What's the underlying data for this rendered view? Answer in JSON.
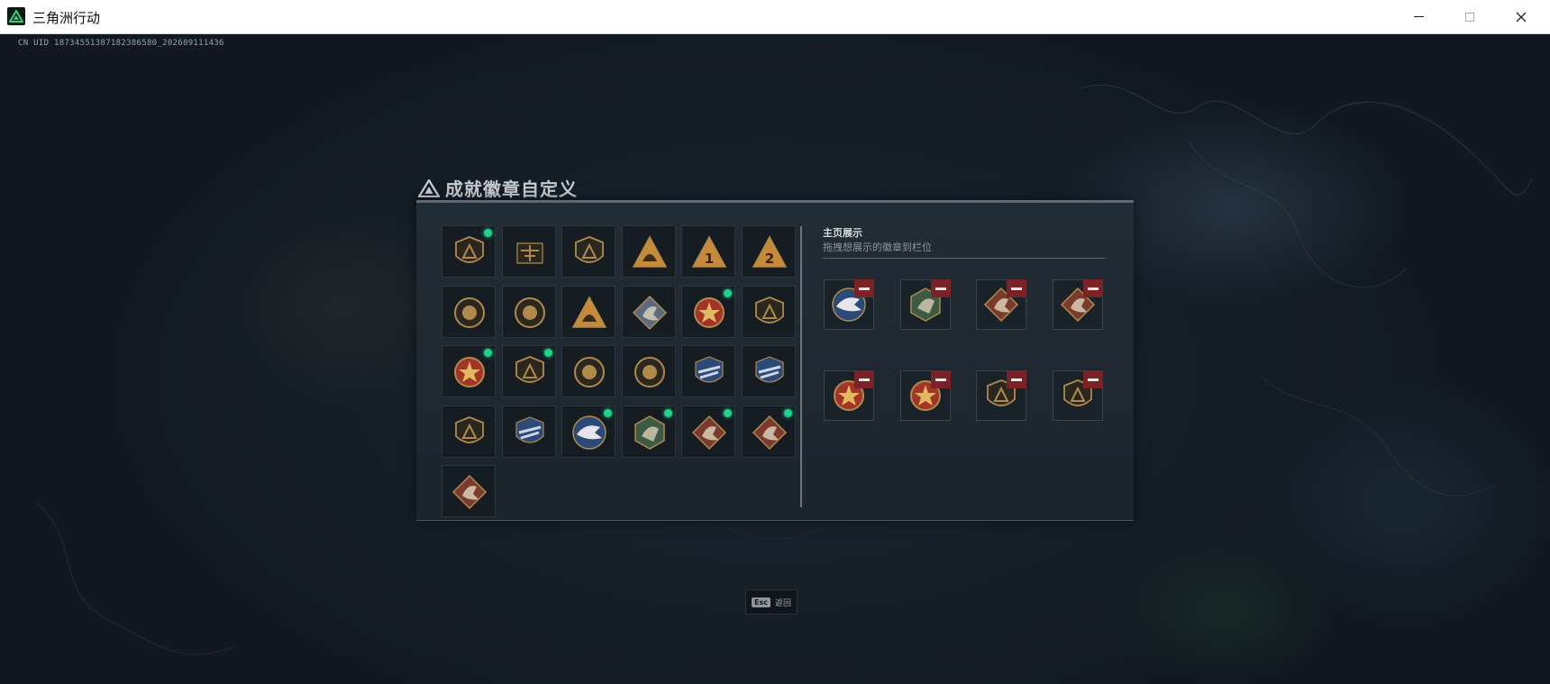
{
  "window": {
    "title": "三角洲行动",
    "controls": [
      "minimize-icon",
      "maximize-icon",
      "close-icon"
    ]
  },
  "uid_text": "CN UID 18734551387182386580_202609111436",
  "panel": {
    "title": "成就徽章自定义",
    "title_icon": "triangle-emblem-icon"
  },
  "colors": {
    "new_indicator": "#1fd38a",
    "remove_button": "#7a2226"
  },
  "badge_grid": [
    {
      "icon": "shield-triangle-badge",
      "new": true
    },
    {
      "icon": "helicopter-badge",
      "new": false
    },
    {
      "icon": "shield-arrow-badge",
      "new": false
    },
    {
      "icon": "triangle-helmet-badge",
      "new": false
    },
    {
      "icon": "triangle-number-1-badge",
      "new": false
    },
    {
      "icon": "triangle-number-2-badge",
      "new": false
    },
    {
      "icon": "laurel-medal-badge",
      "new": false
    },
    {
      "icon": "octagon-medal-badge",
      "new": false
    },
    {
      "icon": "mountain-triangle-badge",
      "new": false
    },
    {
      "icon": "diamond-crystal-badge",
      "new": false
    },
    {
      "icon": "star-medal-badge",
      "new": true
    },
    {
      "icon": "small-shield-badge",
      "new": false
    },
    {
      "icon": "starred-shield-medal-badge",
      "new": true
    },
    {
      "icon": "lion-shield-badge",
      "new": true
    },
    {
      "icon": "eagle-seal-badge",
      "new": false
    },
    {
      "icon": "eye-seal-badge",
      "new": false
    },
    {
      "icon": "blue-wings-badge-a",
      "new": false
    },
    {
      "icon": "blue-wings-badge-b",
      "new": false
    },
    {
      "icon": "rifle-shield-badge",
      "new": false
    },
    {
      "icon": "blue-wings-badge-c",
      "new": false
    },
    {
      "icon": "eagle-round-badge",
      "new": true
    },
    {
      "icon": "green-beast-hex-badge",
      "new": true
    },
    {
      "icon": "red-dragon-diamond-badge",
      "new": true
    },
    {
      "icon": "red-horse-diamond-badge",
      "new": true
    },
    {
      "icon": "red-scorpion-diamond-badge",
      "new": false
    }
  ],
  "showcase": {
    "title": "主页展示",
    "subtitle": "拖拽想展示的徽章到栏位",
    "slots": [
      {
        "icon": "eagle-round-badge"
      },
      {
        "icon": "green-beast-hex-badge"
      },
      {
        "icon": "red-dragon-diamond-badge"
      },
      {
        "icon": "red-horse-diamond-badge"
      },
      {
        "icon": "starred-shield-medal-badge"
      },
      {
        "icon": "star-medal-badge"
      },
      {
        "icon": "shield-triangle-badge"
      },
      {
        "icon": "lion-shield-badge"
      }
    ]
  },
  "footer": {
    "key": "Esc",
    "label": "返回"
  }
}
